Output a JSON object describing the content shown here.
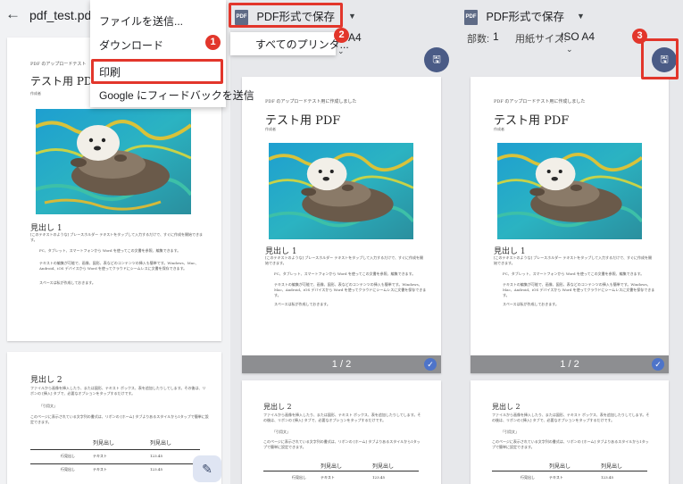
{
  "viewer": {
    "file_name": "pdf_test.pdf",
    "back_icon": "arrow-left-icon"
  },
  "menu": {
    "items": [
      {
        "label": "ファイルを送信..."
      },
      {
        "label": "ダウンロード"
      },
      {
        "label": "印刷"
      },
      {
        "label": "Google にフィードバックを送信"
      }
    ]
  },
  "print_middle": {
    "destination": "PDF形式で保存",
    "dropdown_option": "すべてのプリンタ...",
    "paper_fragment": "A4"
  },
  "print_right": {
    "destination": "PDF形式で保存",
    "copies_label": "部数:",
    "copies_value": "1",
    "paper_label": "用紙サイズ:",
    "paper_value": "ISO A4"
  },
  "annotations": {
    "step1": "1",
    "step2": "2",
    "step3": "3",
    "highlight_color": "#e2362b"
  },
  "preview": {
    "page_indicator": "1 / 2"
  },
  "document": {
    "intro": "PDF のアップロードテスト用に作成しました",
    "intro_short": "PDF のアップロードテスト",
    "title": "テスト用 PDF",
    "title_short": "テスト用 PDF",
    "author": "作成者",
    "heading1": "見出し 1",
    "para1": "[このテキストのような] プレースホルダー テキストをタップして入力するだけで、すぐに作成を開始できます。",
    "bullet1": "PC、タブレット、スマートフォンから Word を使ってこの文書を参照、編集できます。",
    "bullet2": "テキストの編集が可能で、画像、図形、表などのコンテンツの挿入も簡単です。Windows、Mac、Android、iOS デバイスから Word を使ってクラウドにシームレスに文書を保存できます。",
    "bullet3": "スペースは私が作成しておきます。",
    "heading2": "見出し 2",
    "para2": "ファイルから画像を挿入したり、または図形、テキスト ボックス、表を追加したりしてします。その後は、リボンの [挿入] タブで、必要なオプションをタップするだけです。",
    "quote": "「引用文」",
    "para3": "このページに表示されている文字列の書式は、リボンの [ホーム] タブよりあるスタイルから1タップで簡単に設定できます。",
    "table_headers": [
      "列見出し",
      "列見出し"
    ],
    "table_rows": [
      {
        "head": "行見出し",
        "c1": "テキスト",
        "c2": "123.45"
      },
      {
        "head": "行見出し",
        "c1": "テキスト",
        "c2": "123.45"
      }
    ]
  },
  "icons": {
    "save": "save-icon",
    "edit": "edit-pen-icon",
    "check": "check-icon"
  }
}
